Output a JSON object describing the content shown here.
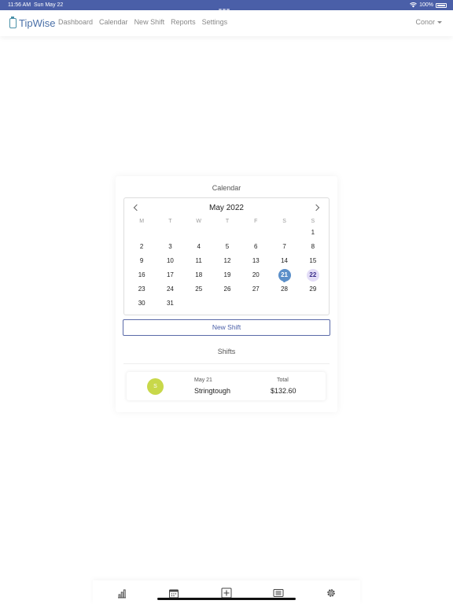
{
  "status_bar": {
    "time": "11:56 AM",
    "date": "Sun May 22",
    "battery": "100%"
  },
  "brand": {
    "name": "TipWise",
    "color": "#4a70a8"
  },
  "nav": {
    "links": [
      "Dashboard",
      "Calendar",
      "New Shift",
      "Reports",
      "Settings"
    ],
    "user": "Conor"
  },
  "card": {
    "title": "Calendar"
  },
  "calendar": {
    "month_label": "May 2022",
    "weekdays": [
      "M",
      "T",
      "W",
      "T",
      "F",
      "S",
      "S"
    ],
    "leading_blanks": 6,
    "days_in_month": 31,
    "selected_day": 21,
    "today_day": 22,
    "selected_color": "#5b8fc9",
    "today_color": "#e3ddf7"
  },
  "actions": {
    "new_shift_label": "New Shift"
  },
  "shifts": {
    "label": "Shifts",
    "items": [
      {
        "initial": "S",
        "date": "May 21",
        "name": "Stringtough",
        "total_label": "Total",
        "total": "$132.60",
        "avatar_color": "#c8d84a"
      }
    ]
  },
  "tabbar": {
    "icons": [
      "bar-chart-icon",
      "calendar-icon",
      "plus-square-icon",
      "list-icon",
      "gear-icon"
    ]
  }
}
